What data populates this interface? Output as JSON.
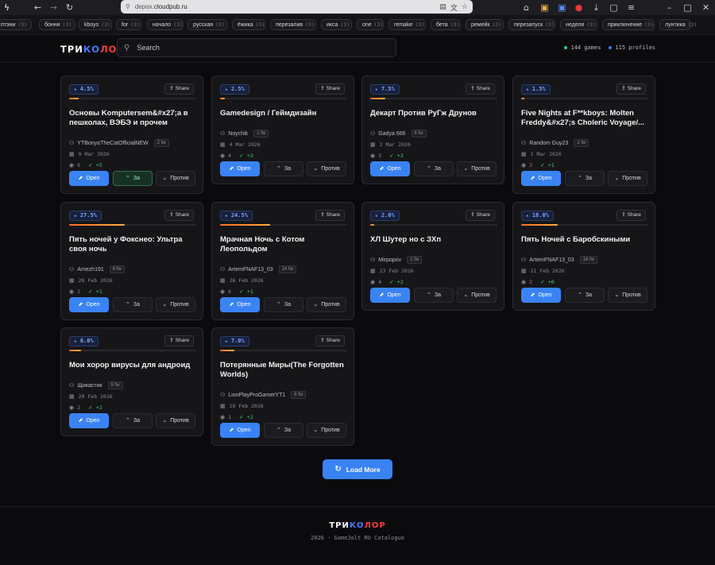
{
  "browser": {
    "url_domain": "cloudpub.ru",
    "url_prefix": "depox.",
    "ext_badge_1": "15",
    "ext_badge_2": "2"
  },
  "tags": [
    {
      "label": "птэни",
      "count": "(3)"
    },
    {
      "label": "бонни",
      "count": "(3)"
    },
    {
      "label": "kboys",
      "count": "(3)"
    },
    {
      "label": "for",
      "count": "(3)"
    },
    {
      "label": "начало",
      "count": "(3)"
    },
    {
      "label": "русская",
      "count": "(3)"
    },
    {
      "label": "ёжика",
      "count": "(3)"
    },
    {
      "label": "перезалив",
      "count": "(3)"
    },
    {
      "label": "икса",
      "count": "(3)"
    },
    {
      "label": "one",
      "count": "(3)"
    },
    {
      "label": "remake",
      "count": "(3)"
    },
    {
      "label": "бета",
      "count": "(3)"
    },
    {
      "label": "ремейк",
      "count": "(3)"
    },
    {
      "label": "перезапуск",
      "count": "(3)"
    },
    {
      "label": "неделя",
      "count": "(3)"
    },
    {
      "label": "приключение",
      "count": "(3)"
    },
    {
      "label": "лунтика",
      "count": "(3)"
    }
  ],
  "header": {
    "logo_part1": "ТРИ",
    "logo_part2": "КО",
    "logo_part3": "ЛОР",
    "search_placeholder": "Search",
    "games_stat": "144 games",
    "profiles_stat": "115 profiles",
    "games_dot_color": "#2fd07a",
    "profiles_dot_color": "#3f7bff"
  },
  "cards": [
    {
      "percent": "4.5%",
      "pct": 4.5,
      "title": "Основы Komputersem&#x27;а в пешколах, ВЭБЭ и прочем",
      "author": "YTBonyaTheCatOfficialNEW",
      "fw": "2 fw",
      "date": "9 Mar 2026",
      "views": "9",
      "votes": "+5",
      "za_active": true
    },
    {
      "percent": "2.5%",
      "pct": 2.5,
      "title": "Gamedesign / Геймдизайн",
      "author": "Noychik",
      "fw": "1 fw",
      "date": "4 Mar 2026",
      "views": "4",
      "votes": "+3",
      "za_active": false
    },
    {
      "percent": "7.5%",
      "pct": 7.5,
      "title": "Декарт Против РуГж Друнов",
      "author": "Gadya 666",
      "fw": "6 fw",
      "date": "2 Mar 2026",
      "views": "3",
      "votes": "+3",
      "za_active": false
    },
    {
      "percent": "1.5%",
      "pct": 1.5,
      "title": "Five Nights at F**kboys: Molten Freddy&#x27;s Choleric Voyage/...",
      "author": "Random Guy23",
      "fw": "1 fw",
      "date": "1 Mar 2026",
      "views": "2",
      "votes": "+1",
      "za_active": false
    },
    {
      "percent": "27.5%",
      "pct": 27.5,
      "title": "Пять ночей у Фокснео: Ультра своя ночь",
      "author": "Amezh191",
      "fw": "8 fw",
      "date": "28 Feb 2026",
      "views": "2",
      "votes": "+1",
      "za_active": false
    },
    {
      "percent": "24.5%",
      "pct": 24.5,
      "title": "Мрачная Ночь с Котом Леопольдом",
      "author": "ArtemFNAF13_03",
      "fw": "24 fw",
      "date": "26 Feb 2026",
      "views": "6",
      "votes": "+1",
      "za_active": false
    },
    {
      "percent": "2.0%",
      "pct": 2.0,
      "title": "ХЛ Шутер но с ЗХп",
      "author": "Mirpopov",
      "fw": "1 fw",
      "date": "23 Feb 2026",
      "views": "4",
      "votes": "+2",
      "za_active": false
    },
    {
      "percent": "18.0%",
      "pct": 18.0,
      "title": "Пять Ночей с Баробскиными",
      "author": "ArtemFNAF13_03",
      "fw": "16 fw",
      "date": "21 Feb 2026",
      "views": "2",
      "votes": "+0",
      "za_active": false
    },
    {
      "percent": "6.0%",
      "pct": 6.0,
      "title": "Мои хорор вирусы для андроид",
      "author": "Щикастик",
      "fw": "5 fw",
      "date": "20 Feb 2026",
      "views": "2",
      "votes": "+2",
      "za_active": false
    },
    {
      "percent": "7.0%",
      "pct": 7.0,
      "title": "Потерянные Миры(The Forgotten Worlds)",
      "author": "LionPlayProGamerYT1",
      "fw": "6 fw",
      "date": "19 Feb 2026",
      "views": "1",
      "votes": "+2",
      "za_active": false
    }
  ],
  "labels": {
    "share": "Share",
    "open": "Open",
    "za": "За",
    "protiv": "Против",
    "load_more": "Load More"
  },
  "footer": {
    "logo_part1": "ТРИ",
    "logo_part2": "КО",
    "logo_part3": "ЛОР",
    "copyright": "2026 · GameJolt RU Catalogue"
  }
}
